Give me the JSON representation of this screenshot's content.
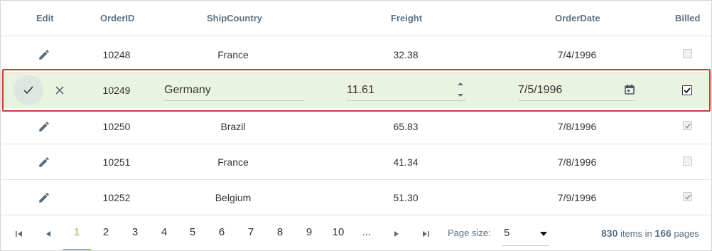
{
  "header": {
    "edit": "Edit",
    "order_id": "OrderID",
    "ship_country": "ShipCountry",
    "freight": "Freight",
    "order_date": "OrderDate",
    "billed": "Billed"
  },
  "rows": [
    {
      "order_id": "10248",
      "ship_country": "France",
      "freight": "32.38",
      "order_date": "7/4/1996",
      "billed": false
    },
    {
      "order_id": "10249",
      "ship_country": "Germany",
      "freight": "11.61",
      "order_date": "7/5/1996",
      "billed": true,
      "editing": true
    },
    {
      "order_id": "10250",
      "ship_country": "Brazil",
      "freight": "65.83",
      "order_date": "7/8/1996",
      "billed": true
    },
    {
      "order_id": "10251",
      "ship_country": "France",
      "freight": "41.34",
      "order_date": "7/8/1996",
      "billed": false
    },
    {
      "order_id": "10252",
      "ship_country": "Belgium",
      "freight": "51.30",
      "order_date": "7/9/1996",
      "billed": true
    }
  ],
  "pager": {
    "pages": [
      "1",
      "2",
      "3",
      "4",
      "5",
      "6",
      "7",
      "8",
      "9",
      "10",
      "..."
    ],
    "active_page": "1",
    "page_size_label": "Page size:",
    "page_size_value": "5",
    "total_items": "830",
    "items_in_text": "items in",
    "total_pages": "166",
    "pages_text": "pages"
  },
  "icons": {
    "edit": "pencil-icon",
    "save": "check-icon",
    "cancel": "close-icon",
    "calendar": "calendar-icon",
    "spinner": "spinner-arrows-icon",
    "first": "first-page-icon",
    "prev": "prev-page-icon",
    "next": "next-page-icon",
    "last": "last-page-icon",
    "dropdown": "caret-down-icon"
  },
  "colors": {
    "header_text": "#5b7282",
    "edit_row_bg": "#eaf3df",
    "edit_outline": "#d13a3a",
    "active_page": "#8ab34a"
  }
}
